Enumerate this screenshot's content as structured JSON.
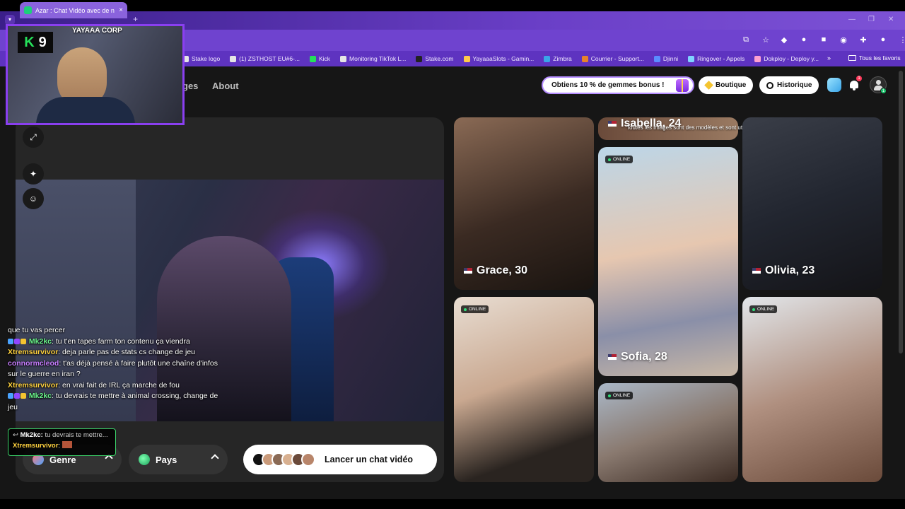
{
  "browser": {
    "tab_title": "Azar : Chat Vidéo avec de n",
    "bookmarks": [
      "Stake logo",
      "(1) ZSTHOST EU#6-...",
      "Kick",
      "Monitoring TikTok L...",
      "Stake.com",
      "YayaaaSlots - Gamin...",
      "Zimbra",
      "Courrier - Support...",
      "Djinni",
      "Ringover - Appels",
      "Dokploy - Deploy y..."
    ],
    "all_bookmarks_label": "Tous les favoris"
  },
  "nav": {
    "partial_link": "ges",
    "about": "About"
  },
  "header": {
    "promo_label": "Obtiens 10 % de gemmes bonus !",
    "shop_label": "Boutique",
    "history_label": "Historique",
    "notification_count": "1",
    "profile_badge": "1"
  },
  "video": {
    "gender_label": "Genre",
    "country_label": "Pays",
    "launch_label": "Lancer un chat vidéo"
  },
  "cards": {
    "disclaimer": "Toutes les images sont des modèles et sont utilisées à des fins d'illustration uniquement.",
    "online_label": "ONLINE",
    "isabella": "Isabella, 24",
    "grace": "Grace, 30",
    "sofia": "Sofia, 28",
    "olivia": "Olivia, 23"
  },
  "overlay": {
    "corp_name": "YAYAAA CORP",
    "logo_k": "K",
    "logo_9": "9"
  },
  "chat": {
    "m0_text": "que tu vas percer",
    "m1_user": "Mk2kc",
    "m1_text": ": tu t'en tapes farm ton contenu ça viendra",
    "m2_user": "Xtremsurvivor",
    "m2_text": ": deja parle pas de stats cs change de jeu",
    "m3_user": "connormcleod",
    "m3_text": ": t'as déjà pensé à faire plutôt une chaîne d'infos sur le guerre en iran ?",
    "m4_user": "Xtremsurvivor",
    "m4_text": ": en vrai fait de IRL ça marche de fou",
    "m5_user": "Mk2kc",
    "m5_text": ": tu devrais te mettre à animal crossing, change de jeu",
    "reply_to": "Mk2kc:",
    "reply_preview": "tu devrais te mettre...",
    "reply_user": "Xtremsurvivor",
    "reply_sep": ":"
  },
  "colors": {
    "accent_purple": "#6f43cf",
    "online_green": "#2fe07a",
    "card_bg": "#161616"
  }
}
